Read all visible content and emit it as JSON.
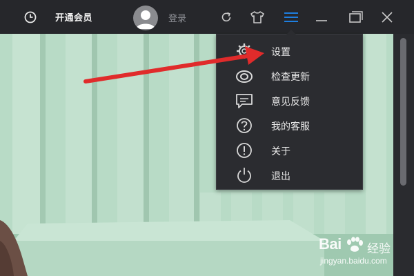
{
  "titlebar": {
    "vip_label": "开通会员",
    "login_label": "登录",
    "icons": [
      "history-icon",
      "refresh-icon",
      "skin-icon",
      "menu-icon",
      "minimize-icon",
      "maximize-icon",
      "close-icon"
    ],
    "accent": "#1e7fe0",
    "background": "#26272b"
  },
  "menu": {
    "items": [
      {
        "label": "设置",
        "icon": "gear-icon"
      },
      {
        "label": "检查更新",
        "icon": "update-icon"
      },
      {
        "label": "意见反馈",
        "icon": "feedback-icon"
      },
      {
        "label": "我的客服",
        "icon": "help-icon"
      },
      {
        "label": "关于",
        "icon": "info-icon"
      },
      {
        "label": "退出",
        "icon": "power-icon"
      }
    ]
  },
  "annotation": {
    "arrow_color": "#e02b2b"
  },
  "watermark": {
    "brand": "Bai",
    "brand_suffix": "经验",
    "url": "jingyan.baidu.com"
  }
}
